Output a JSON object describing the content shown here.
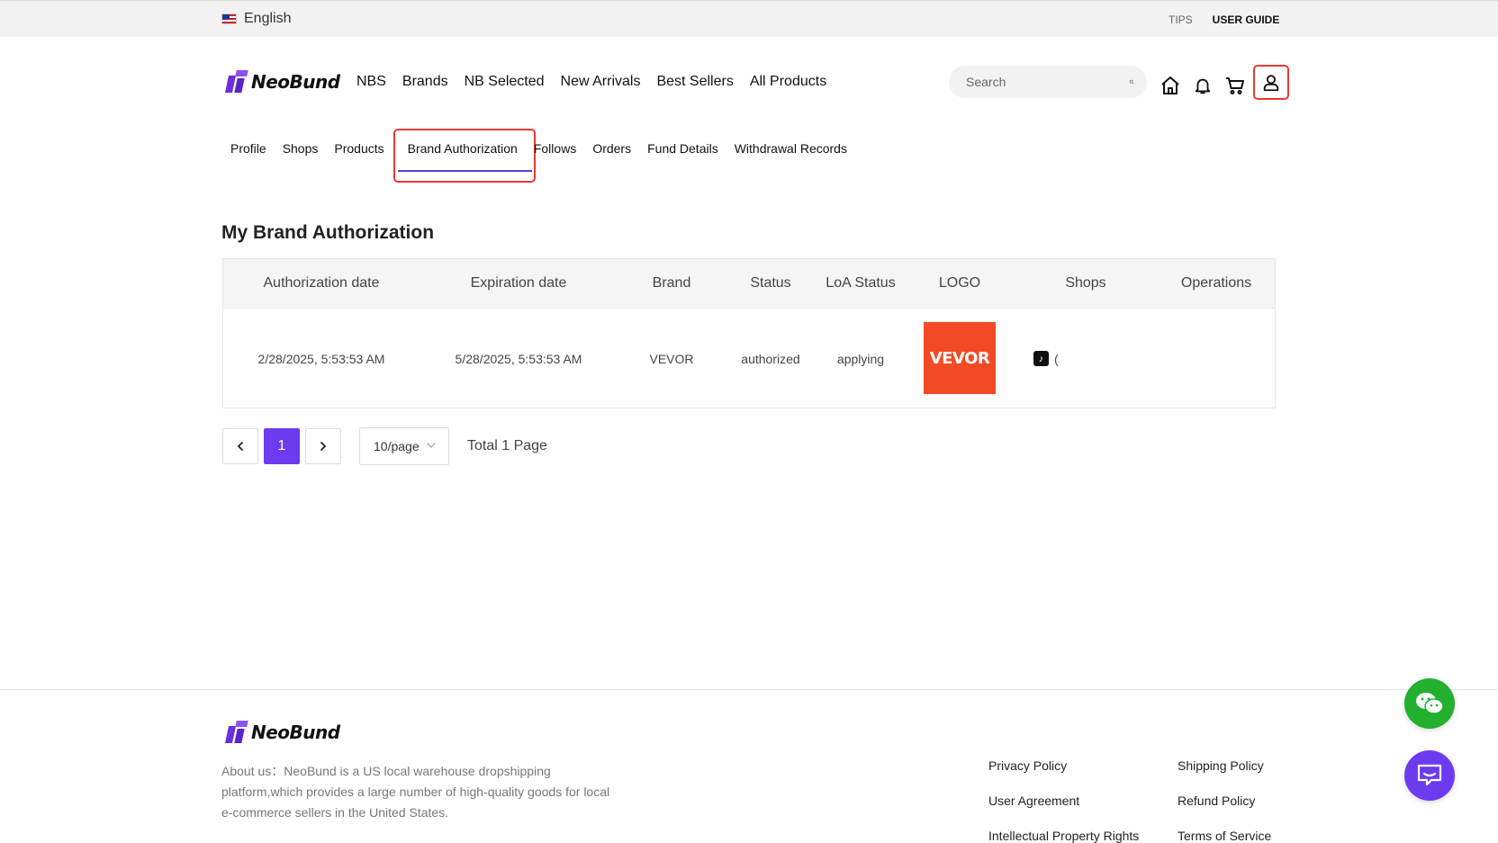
{
  "topbar": {
    "language": "English",
    "tips": "TIPS",
    "user_guide": "USER GUIDE"
  },
  "brand": {
    "name": "NeoBund"
  },
  "nav": [
    "NBS",
    "Brands",
    "NB Selected",
    "New Arrivals",
    "Best Sellers",
    "All Products"
  ],
  "search": {
    "placeholder": "Search"
  },
  "header_icons": [
    "home-icon",
    "bell-icon",
    "cart-icon",
    "user-icon"
  ],
  "subnav": {
    "items": [
      "Profile",
      "Shops",
      "Products",
      "Brand Authorization",
      "Follows",
      "Orders",
      "Fund Details",
      "Withdrawal Records"
    ],
    "active": "Brand Authorization"
  },
  "section_title": "My Brand Authorization",
  "table": {
    "columns": [
      "Authorization date",
      "Expiration date",
      "Brand",
      "Status",
      "LoA Status",
      "LOGO",
      "Shops",
      "Operations"
    ],
    "rows": [
      {
        "authorization_date": "2/28/2025, 5:53:53 AM",
        "expiration_date": "5/28/2025, 5:53:53 AM",
        "brand": "VEVOR",
        "status": "authorized",
        "loa_status": "applying",
        "logo_text": "VEVOR",
        "shop_label": "(",
        "operations": ""
      }
    ]
  },
  "pagination": {
    "current": "1",
    "page_size": "10/page",
    "total": "Total 1 Page"
  },
  "footer": {
    "about": "About us：NeoBund is a US local warehouse dropshipping platform,which provides a large number of high-quality goods for local e-commerce sellers in the United States.",
    "links_col1": [
      "Privacy Policy",
      "User Agreement",
      "Intellectual Property Rights"
    ],
    "links_col2": [
      "Shipping Policy",
      "Refund Policy",
      "Terms of Service"
    ]
  },
  "colors": {
    "accent": "#6c3bf0",
    "highlight": "#e53935",
    "wechat": "#22b02e",
    "vevor": "#f24a25"
  }
}
